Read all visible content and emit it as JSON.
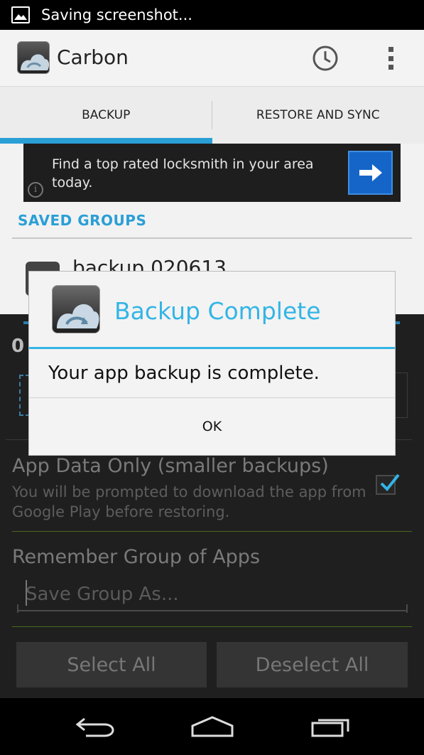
{
  "status_bar": {
    "notification_text": "Saving screenshot...",
    "icon": "image-icon"
  },
  "action_bar": {
    "title": "Carbon",
    "history_icon": "clock-icon",
    "menu_icon": "overflow-menu-icon"
  },
  "tabs": [
    {
      "label": "BACKUP",
      "active": true
    },
    {
      "label": "RESTORE AND SYNC",
      "active": false
    }
  ],
  "ad": {
    "text": "Find a top rated locksmith in your area today.",
    "info_icon": "info-icon",
    "action_icon": "arrow-right-icon"
  },
  "saved_groups": {
    "header": "SAVED GROUPS",
    "items": [
      {
        "name": "backup 020613"
      }
    ]
  },
  "selection": {
    "count": "0"
  },
  "app_data_only": {
    "title": "App Data Only (smaller backups)",
    "description": "You will be prompted to download the app from Google Play before restoring.",
    "checked": true
  },
  "remember_group": {
    "title": "Remember Group of Apps",
    "placeholder": "Save Group As..."
  },
  "buttons": {
    "select_all": "Select All",
    "deselect_all": "Deselect All"
  },
  "dialog": {
    "title": "Backup Complete",
    "message": "Your app backup is complete.",
    "ok_label": "OK"
  },
  "nav": {
    "back_icon": "back-icon",
    "home_icon": "home-icon",
    "recents_icon": "recent-apps-icon"
  },
  "colors": {
    "accent": "#33b5e5",
    "tab_indicator": "#2a9fd6",
    "ad_button": "#1565c8"
  }
}
